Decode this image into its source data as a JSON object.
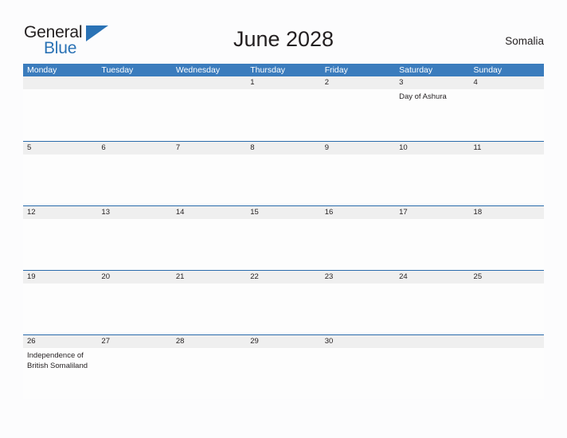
{
  "logo": {
    "word_one": "General",
    "word_two": "Blue",
    "triangle_icon": "triangle-icon",
    "accent_color": "#2a72b5"
  },
  "header": {
    "title": "June 2028",
    "country": "Somalia"
  },
  "colors": {
    "header_blue": "#3b7cbd",
    "row_divider_blue": "#2a6bab",
    "daynum_band": "#efefef",
    "page_background": "#fcfcfd",
    "text": "#231f20"
  },
  "calendar": {
    "weekdays": [
      {
        "label": "Monday"
      },
      {
        "label": "Tuesday"
      },
      {
        "label": "Wednesday"
      },
      {
        "label": "Thursday"
      },
      {
        "label": "Friday"
      },
      {
        "label": "Saturday"
      },
      {
        "label": "Sunday"
      }
    ],
    "weeks": [
      {
        "days": [
          {
            "num": "",
            "event": ""
          },
          {
            "num": "",
            "event": ""
          },
          {
            "num": "",
            "event": ""
          },
          {
            "num": "1",
            "event": ""
          },
          {
            "num": "2",
            "event": ""
          },
          {
            "num": "3",
            "event": "Day of Ashura"
          },
          {
            "num": "4",
            "event": ""
          }
        ]
      },
      {
        "days": [
          {
            "num": "5",
            "event": ""
          },
          {
            "num": "6",
            "event": ""
          },
          {
            "num": "7",
            "event": ""
          },
          {
            "num": "8",
            "event": ""
          },
          {
            "num": "9",
            "event": ""
          },
          {
            "num": "10",
            "event": ""
          },
          {
            "num": "11",
            "event": ""
          }
        ]
      },
      {
        "days": [
          {
            "num": "12",
            "event": ""
          },
          {
            "num": "13",
            "event": ""
          },
          {
            "num": "14",
            "event": ""
          },
          {
            "num": "15",
            "event": ""
          },
          {
            "num": "16",
            "event": ""
          },
          {
            "num": "17",
            "event": ""
          },
          {
            "num": "18",
            "event": ""
          }
        ]
      },
      {
        "days": [
          {
            "num": "19",
            "event": ""
          },
          {
            "num": "20",
            "event": ""
          },
          {
            "num": "21",
            "event": ""
          },
          {
            "num": "22",
            "event": ""
          },
          {
            "num": "23",
            "event": ""
          },
          {
            "num": "24",
            "event": ""
          },
          {
            "num": "25",
            "event": ""
          }
        ]
      },
      {
        "days": [
          {
            "num": "26",
            "event": "Independence of British Somaliland"
          },
          {
            "num": "27",
            "event": ""
          },
          {
            "num": "28",
            "event": ""
          },
          {
            "num": "29",
            "event": ""
          },
          {
            "num": "30",
            "event": ""
          },
          {
            "num": "",
            "event": ""
          },
          {
            "num": "",
            "event": ""
          }
        ]
      }
    ]
  }
}
